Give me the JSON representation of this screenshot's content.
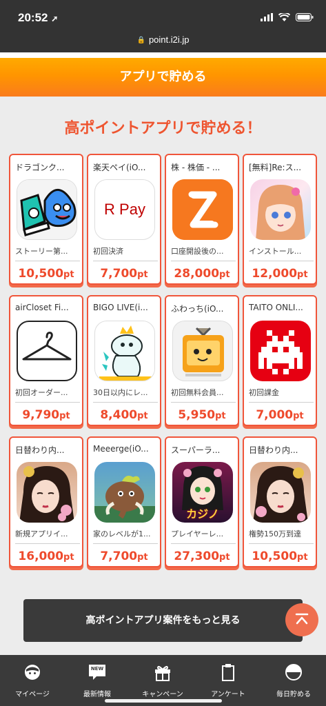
{
  "status": {
    "time": "20:52"
  },
  "browser": {
    "url": "point.i2i.jp"
  },
  "banner": {
    "title": "アプリで貯める"
  },
  "section": {
    "title": "高ポイントアプリで貯める！"
  },
  "apps": [
    {
      "name": "ドラゴンク...",
      "desc": "ストーリー第...",
      "points": "10,500",
      "unit": "pt",
      "icon": "slime-sneaker-icon"
    },
    {
      "name": "楽天ペイ(iO...",
      "desc": "初回決済",
      "points": "7,700",
      "unit": "pt",
      "icon": "rakuten-pay-icon",
      "icon_text": "R Pay"
    },
    {
      "name": "株 - 株価 - ...",
      "desc": "口座開設後の...",
      "points": "28,000",
      "unit": "pt",
      "icon": "stock-app-icon"
    },
    {
      "name": "[無料]Re:ス...",
      "desc": "インストール...",
      "points": "12,000",
      "unit": "pt",
      "icon": "anime-girl-icon"
    },
    {
      "name": "airCloset Fi...",
      "desc": "初回オーダー...",
      "points": "9,790",
      "unit": "pt",
      "icon": "hanger-icon"
    },
    {
      "name": "BIGO LIVE(i...",
      "desc": "30日以内にレ...",
      "points": "8,400",
      "unit": "pt",
      "icon": "bigo-dino-icon"
    },
    {
      "name": "ふわっち(iO...",
      "desc": "初回無料会員...",
      "points": "5,950",
      "unit": "pt",
      "icon": "fuwatch-tv-icon"
    },
    {
      "name": "TAITO ONLI...",
      "desc": "初回課金",
      "points": "7,000",
      "unit": "pt",
      "icon": "space-invader-icon"
    },
    {
      "name": "日替わり内...",
      "desc": "新規アプリイ...",
      "points": "16,000",
      "unit": "pt",
      "icon": "geisha-portrait-icon"
    },
    {
      "name": "Meeerge(iO...",
      "desc": "家のレベルが1...",
      "points": "7,700",
      "unit": "pt",
      "icon": "mammoth-icon"
    },
    {
      "name": "スーパーラ...",
      "desc": "プレイヤーレ...",
      "points": "27,300",
      "unit": "pt",
      "icon": "casino-girl-icon",
      "icon_text": "カジノ"
    },
    {
      "name": "日替わり内...",
      "desc": "権勢150万到達",
      "points": "10,500",
      "unit": "pt",
      "icon": "geisha-portrait-icon"
    }
  ],
  "more_button": {
    "label": "高ポイントアプリ案件をもっと見る"
  },
  "tabbar": {
    "items": [
      {
        "label": "マイページ",
        "icon": "mypage-face-icon"
      },
      {
        "label": "最新情報",
        "icon": "news-icon",
        "badge": "NEW"
      },
      {
        "label": "キャンペーン",
        "icon": "gift-icon"
      },
      {
        "label": "アンケート",
        "icon": "clipboard-icon"
      },
      {
        "label": "毎日貯める",
        "icon": "half-circle-icon"
      }
    ]
  },
  "colors": {
    "accent": "#ee5530",
    "banner": "#ff9500",
    "dark": "#333333"
  }
}
